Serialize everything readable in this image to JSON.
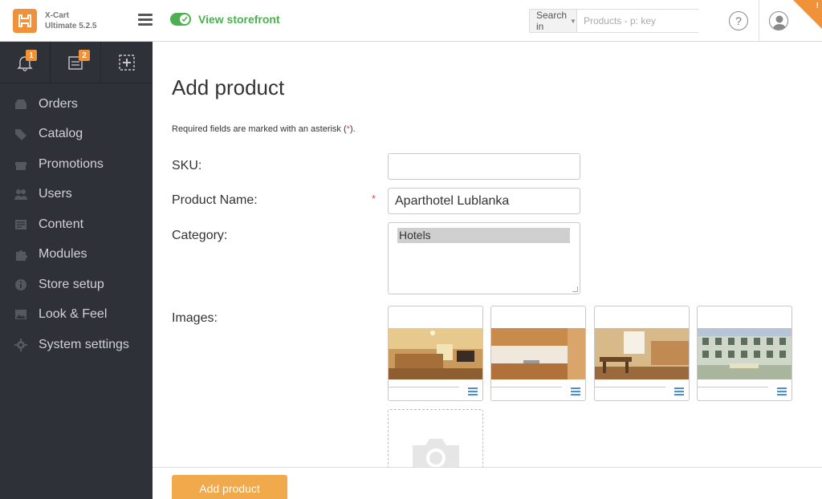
{
  "app": {
    "brand_name": "X-Cart",
    "brand_edition": "Ultimate 5.2.5"
  },
  "header": {
    "storefront_label": "View storefront",
    "search_in_label": "Search in",
    "search_placeholder": "Products - p: key",
    "help_label": "?",
    "corner_mark": "!"
  },
  "quick_actions": [
    {
      "icon": "bell-icon",
      "badge": "1"
    },
    {
      "icon": "orders-icon",
      "badge": "2"
    },
    {
      "icon": "add-icon",
      "badge": ""
    }
  ],
  "sidebar": {
    "items": [
      {
        "label": "Orders",
        "icon": "orders-icon"
      },
      {
        "label": "Catalog",
        "icon": "tag-icon"
      },
      {
        "label": "Promotions",
        "icon": "gift-icon"
      },
      {
        "label": "Users",
        "icon": "users-icon"
      },
      {
        "label": "Content",
        "icon": "content-icon"
      },
      {
        "label": "Modules",
        "icon": "puzzle-icon"
      },
      {
        "label": "Store setup",
        "icon": "info-icon"
      },
      {
        "label": "Look & Feel",
        "icon": "image-icon"
      },
      {
        "label": "System settings",
        "icon": "gear-icon"
      }
    ]
  },
  "form": {
    "title": "Add product",
    "required_note_prefix": "Required fields are marked with an asterisk (",
    "required_note_star": "*",
    "required_note_suffix": ").",
    "sku_label": "SKU:",
    "sku_value": "",
    "name_label": "Product Name:",
    "name_required_mark": "*",
    "name_value": "Aparthotel Lublanka",
    "category_label": "Category:",
    "category_selected": "Hotels",
    "images_label": "Images:",
    "images": [
      {
        "icon": "bedroom-photo"
      },
      {
        "icon": "kitchen-photo"
      },
      {
        "icon": "dining-photo"
      },
      {
        "icon": "facade-photo"
      }
    ],
    "upload_icon": "camera-icon",
    "submit_label": "Add product"
  },
  "colors": {
    "accent": "#f0923a",
    "button": "#f0a94b",
    "sidebar_bg": "#2f3139",
    "storefront_green": "#4caf50",
    "required_red": "#e04b4b"
  }
}
